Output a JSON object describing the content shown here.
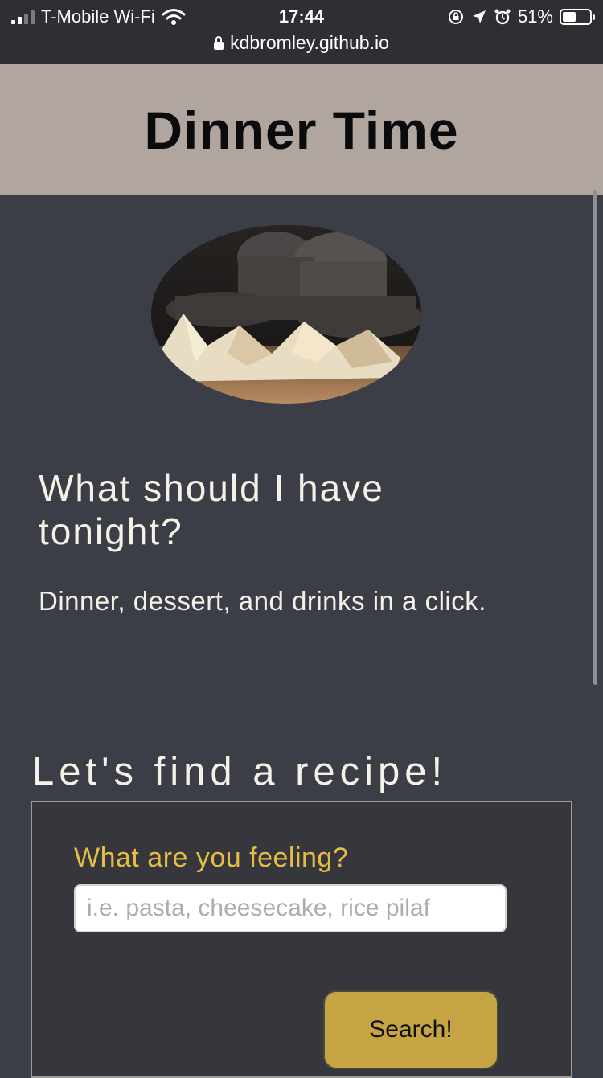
{
  "status_bar": {
    "carrier": "T-Mobile Wi-Fi",
    "time": "17:44",
    "battery_percent": "51%",
    "battery_level": 0.51,
    "url": "kdbromley.github.io"
  },
  "header": {
    "title": "Dinner Time"
  },
  "hero": {
    "headline": "What should I have tonight?",
    "tagline": "Dinner, dessert, and drinks in a click."
  },
  "search": {
    "heading": "Let's find a recipe!",
    "label": "What are you feeling?",
    "placeholder": "i.e. pasta, cheesecake, rice pilaf",
    "button_label": "Search!"
  },
  "colors": {
    "page_background": "#3b3e46",
    "header_background": "#b1a69f",
    "accent_label": "#e5bd45",
    "button": "#c4a443",
    "text_light": "#f4f1e6"
  }
}
